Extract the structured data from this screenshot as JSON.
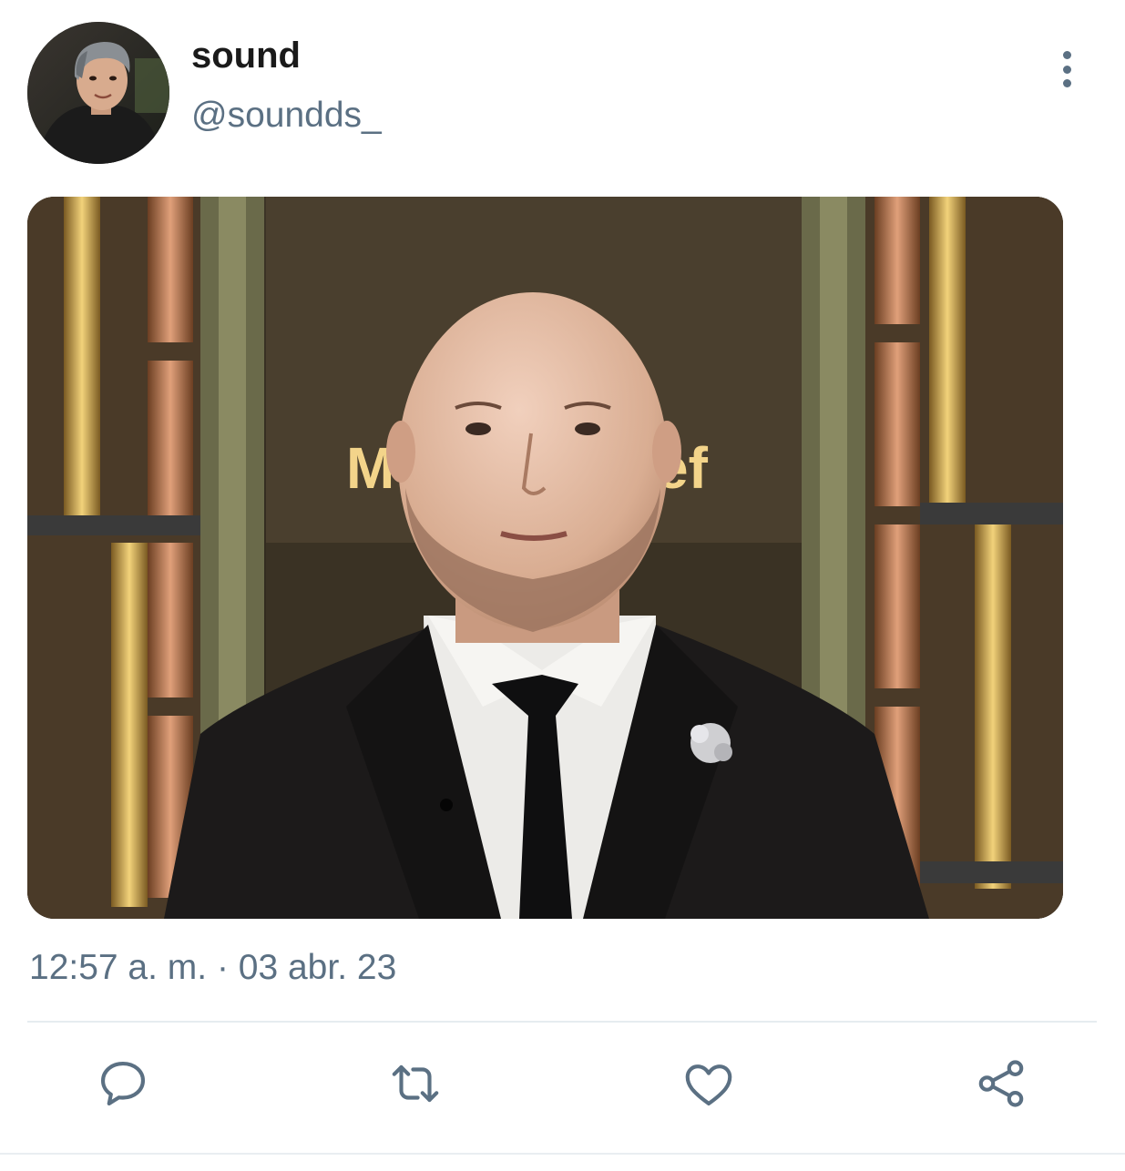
{
  "tweet": {
    "display_name": "sound",
    "handle": "@soundds_",
    "timestamp": "12:57 a. m. · 03 abr. 23",
    "media": {
      "description_icon": "photo",
      "sign_text": "MasterChef"
    }
  },
  "actions": [
    {
      "name": "reply",
      "icon": "speech-bubble-icon"
    },
    {
      "name": "retweet",
      "icon": "retweet-arrows-icon"
    },
    {
      "name": "like",
      "icon": "heart-icon"
    },
    {
      "name": "share",
      "icon": "share-nodes-icon"
    }
  ],
  "colors": {
    "text_primary": "#1a1a1a",
    "text_secondary": "#5b7083",
    "divider": "#e6ecf0"
  }
}
